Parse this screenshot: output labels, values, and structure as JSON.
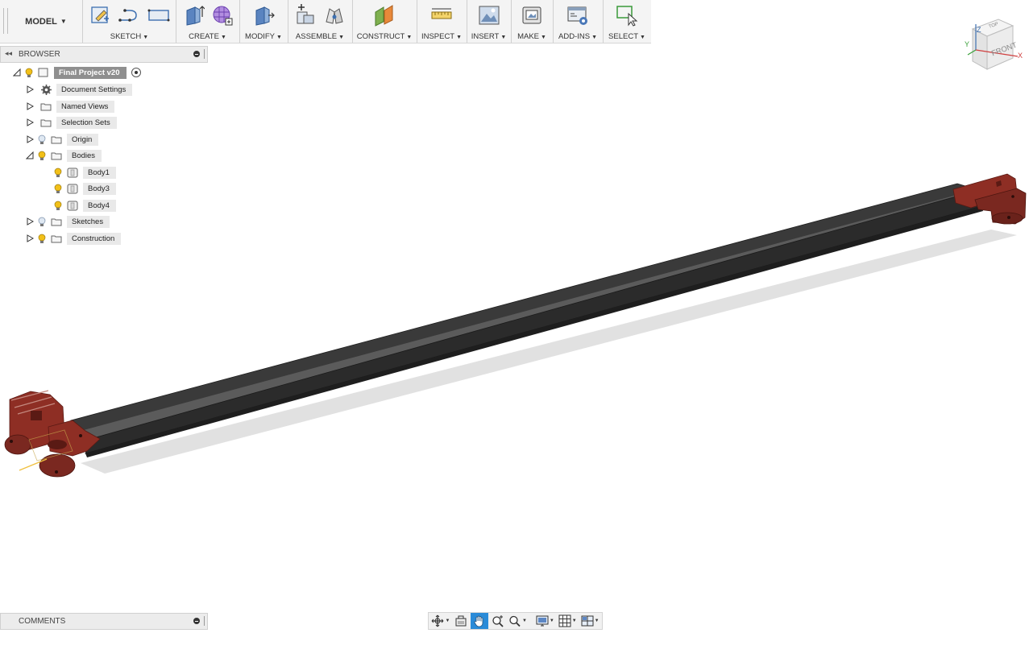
{
  "toolbar": {
    "workspace": "MODEL",
    "groups": {
      "sketch": "SKETCH",
      "create": "CREATE",
      "modify": "MODIFY",
      "assemble": "ASSEMBLE",
      "construct": "CONSTRUCT",
      "inspect": "INSPECT",
      "insert": "INSERT",
      "make": "MAKE",
      "addins": "ADD-INS",
      "select": "SELECT"
    }
  },
  "browser": {
    "title": "BROWSER",
    "root": "Final Project v20",
    "items": [
      {
        "label": "Document Settings",
        "icon": "gear-icon"
      },
      {
        "label": "Named Views",
        "icon": "folder-icon"
      },
      {
        "label": "Selection Sets",
        "icon": "folder-icon"
      },
      {
        "label": "Origin",
        "icon": "folder-icon"
      },
      {
        "label": "Bodies",
        "icon": "folder-icon"
      },
      {
        "label": "Body1",
        "icon": "body-icon"
      },
      {
        "label": "Body3",
        "icon": "body-icon"
      },
      {
        "label": "Body4",
        "icon": "body-icon"
      },
      {
        "label": "Sketches",
        "icon": "folder-icon"
      },
      {
        "label": "Construction",
        "icon": "folder-icon"
      }
    ]
  },
  "viewcube": {
    "top": "TOP",
    "front": "FRONT",
    "axis_x": "X",
    "axis_y": "Y",
    "axis_z": "Z"
  },
  "comments": {
    "title": "COMMENTS"
  },
  "colors": {
    "body_red": "#8e2e24",
    "rail_dark": "#2f2f2f",
    "active_blue": "#2a8bd8",
    "bulb_yellow": "#f2c019"
  }
}
